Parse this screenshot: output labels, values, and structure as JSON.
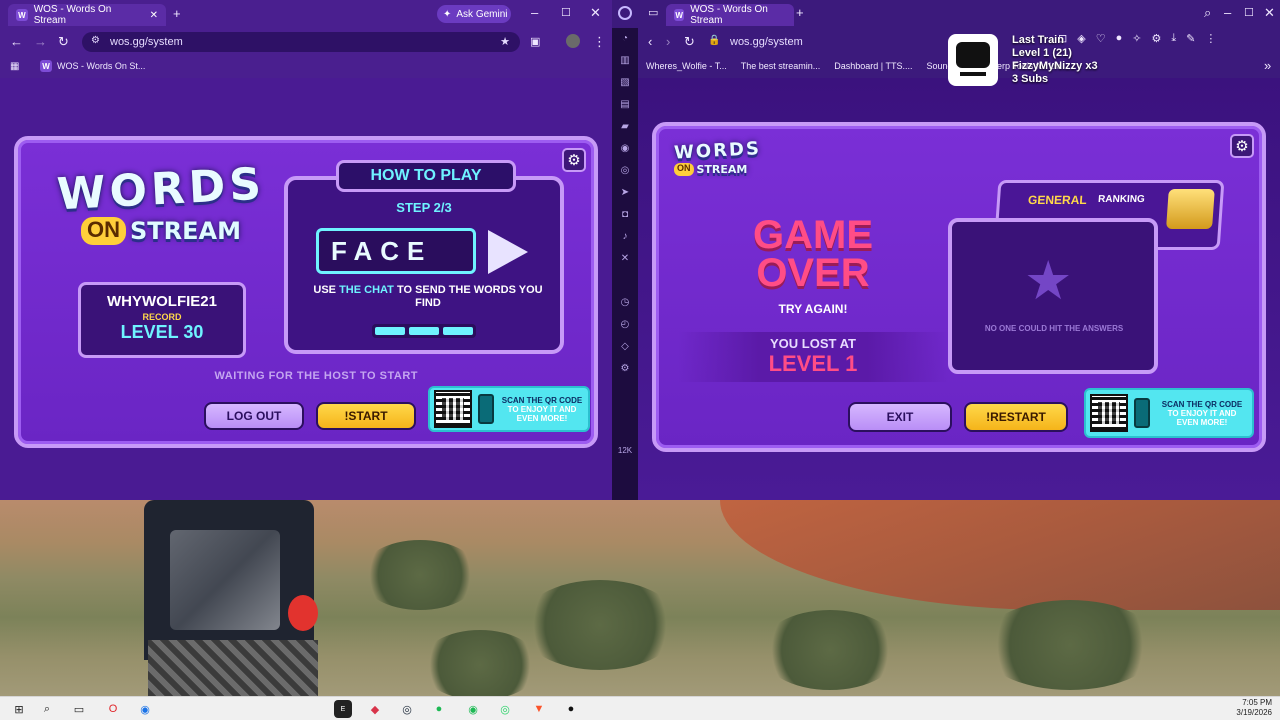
{
  "left_window": {
    "tab_title": "WOS - Words On Stream",
    "new_tab": "+",
    "ask_gemini": "Ask Gemini",
    "url": "wos.gg/system",
    "bookmark": "WOS - Words On St...",
    "game": {
      "logo_top": "WORDS",
      "logo_on": "ON",
      "logo_stream": "STREAM",
      "username": "WHYWOLFIE21",
      "record_label": "RECORD",
      "level_text": "LEVEL 30",
      "how_to_play": "HOW TO PLAY",
      "step": "STEP 2/3",
      "typed_word": "FACE",
      "instruction_pre": "USE",
      "instruction_hl": "THE CHAT",
      "instruction_post": "TO SEND THE WORDS YOU FIND",
      "waiting_text": "WAITING FOR THE HOST TO START",
      "logout_label": "LOG OUT",
      "start_label": "!START",
      "qr_text_a": "SCAN THE QR CODE",
      "qr_text_b": "TO ENJOY IT AND EVEN MORE!"
    }
  },
  "right_window": {
    "tab_title": "WOS - Words On Stream",
    "new_tab": "+",
    "url": "wos.gg/system",
    "bookmarks": [
      "Wheres_Wolfie - T...",
      "The best streamin...",
      "Dashboard | TTS....",
      "Sound Ale...",
      "Blerp Tools for Liv..."
    ],
    "overlay": {
      "title": "Last Train",
      "level": "Level 1  (21)",
      "user": "FizzyMyNizzy x3",
      "subs": "3 Subs"
    },
    "game": {
      "game_over_1": "GAME",
      "game_over_2": "OVER",
      "try_again": "TRY AGAIN!",
      "lost_at": "YOU LOST AT",
      "lost_level": "LEVEL 1",
      "ranking_general": "GENERAL",
      "ranking_label": "RANKING",
      "no_one": "NO ONE COULD HIT THE ANSWERS",
      "exit_label": "EXIT",
      "restart_label": "!RESTART",
      "qr_text_a": "SCAN THE QR CODE",
      "qr_text_b": "TO ENJOY IT AND EVEN MORE!"
    },
    "dock_label": "12K"
  },
  "taskbar": {
    "time": "7:05 PM",
    "date": "3/19/2026"
  },
  "colors": {
    "panel_border": "#c79af7",
    "panel_bg": "#7a2fd6",
    "accent_yellow": "#ffd84a",
    "game_over_pink": "#ff4d86",
    "qr_cyan": "#53e6f0"
  }
}
